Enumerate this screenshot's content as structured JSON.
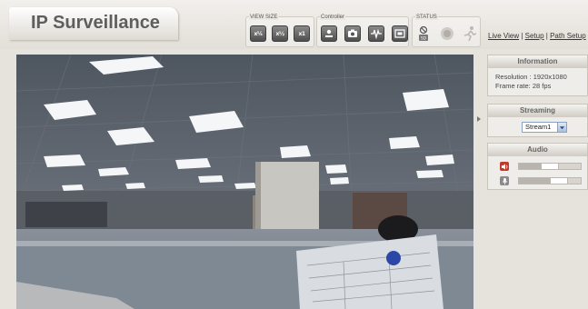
{
  "header": {
    "logo_text": "IP Surveillance"
  },
  "toolbar": {
    "view_size": {
      "label": "VIEW SIZE",
      "buttons": [
        {
          "label": "x¼",
          "icon": "quarter-size-icon"
        },
        {
          "label": "x½",
          "icon": "half-size-icon"
        },
        {
          "label": "x1",
          "icon": "full-size-icon"
        }
      ]
    },
    "controller": {
      "label": "Controller",
      "buttons": [
        {
          "icon": "record-icon"
        },
        {
          "icon": "camera-icon"
        },
        {
          "icon": "audio-wave-icon"
        },
        {
          "icon": "fullscreen-icon"
        }
      ]
    },
    "status": {
      "label": "STATUS",
      "icons": [
        {
          "icon": "sd-card-icon"
        },
        {
          "icon": "alarm-icon"
        },
        {
          "icon": "motion-icon"
        }
      ]
    }
  },
  "nav": {
    "links": [
      "Live View",
      "Setup",
      "Path Setup"
    ],
    "separator": "|"
  },
  "information": {
    "title": "Information",
    "resolution_label": "Resolution : 1920x1080",
    "frame_rate_label": "Frame rate: 28 fps"
  },
  "streaming": {
    "title": "Streaming",
    "selected": "Stream1"
  },
  "audio": {
    "title": "Audio",
    "speaker_level": 0.5,
    "mic_level": 0.7
  },
  "colors": {
    "accent_red": "#c0392b",
    "button_dark": "#5a5a5a",
    "panel_bg": "#efede9"
  }
}
